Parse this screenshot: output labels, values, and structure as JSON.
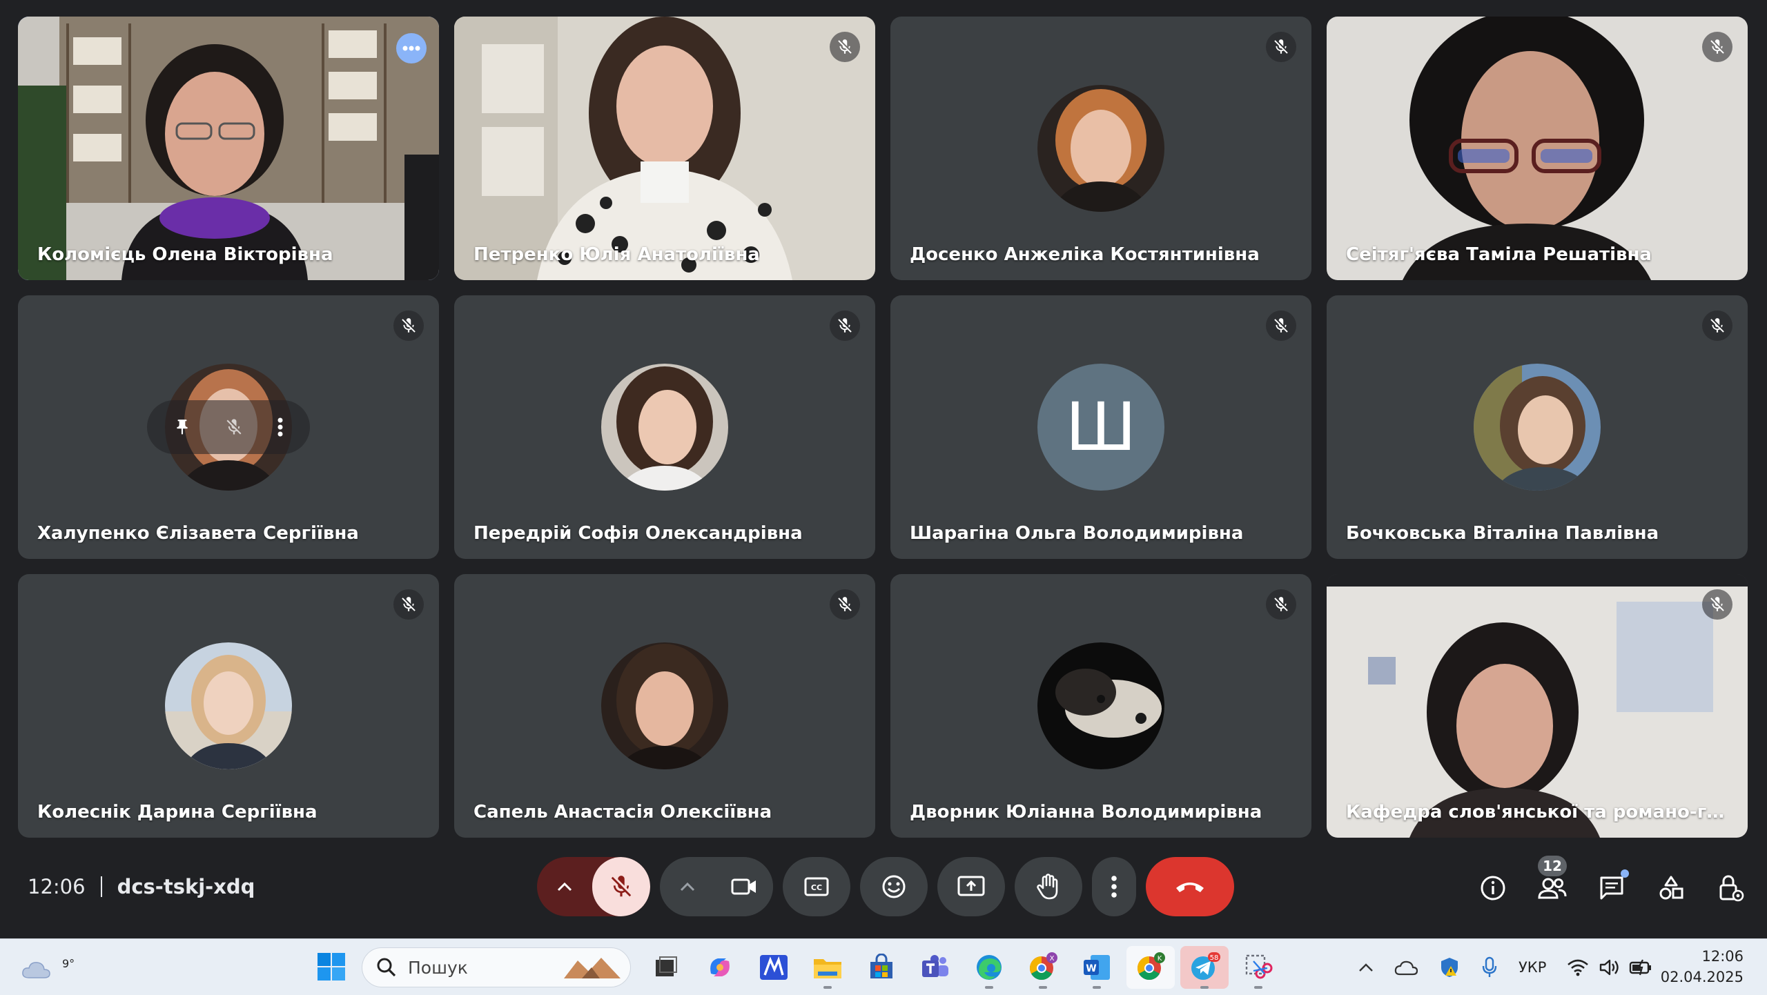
{
  "participants": [
    {
      "name": "Коломієць Олена Вікторівна",
      "type": "video",
      "muted": false,
      "active_speaker": true
    },
    {
      "name": "Петренко Юлія Анатоліївна",
      "type": "video",
      "muted": true
    },
    {
      "name": "Досенко Анжеліка Костянтинівна",
      "type": "avatar-photo",
      "muted": true
    },
    {
      "name": "Сеітяг'яєва Таміла Решатівна",
      "type": "video",
      "muted": true
    },
    {
      "name": "Халупенко Єлізавета Сергіївна",
      "type": "avatar-photo",
      "muted": true,
      "hovered": true
    },
    {
      "name": "Передрій Софія Олександрівна",
      "type": "avatar-photo",
      "muted": true
    },
    {
      "name": "Шарагіна Ольга Володимирівна",
      "type": "avatar-letter",
      "letter": "Ш",
      "muted": true
    },
    {
      "name": "Бочковська Віталіна Павлівна",
      "type": "avatar-photo",
      "muted": true
    },
    {
      "name": "Колеснік Дарина Сергіївна",
      "type": "avatar-photo",
      "muted": true
    },
    {
      "name": "Сапель Анастасія Олексіївна",
      "type": "avatar-photo",
      "muted": true
    },
    {
      "name": "Дворник Юліанна Володимирівна",
      "type": "avatar-photo",
      "muted": true
    },
    {
      "name": "Кафедра слов'янської та романо-германсь...",
      "type": "video",
      "muted": true
    }
  ],
  "meeting": {
    "time": "12:06",
    "code": "dcs-tskj-xdq",
    "participant_count": "12"
  },
  "controls": {
    "icons": [
      "chevron-up-icon",
      "mic-off-icon",
      "chevron-up-icon",
      "videocam-icon",
      "closed-caption-icon",
      "emoji-icon",
      "present-screen-icon",
      "raise-hand-icon",
      "more-vert-icon",
      "call-end-icon"
    ]
  },
  "right_tools": {
    "icons": [
      "info-icon",
      "people-icon",
      "chat-icon",
      "activities-icon",
      "host-controls-icon"
    ]
  },
  "taskbar": {
    "weather_temp": "9°",
    "search_placeholder": "Пошук",
    "telegram_badge": "58",
    "lang": "УКР",
    "clock_time": "12:06",
    "clock_date": "02.04.2025"
  },
  "colors": {
    "background": "#202124",
    "tile": "#3c4043",
    "active_outline": "#8ab4f8",
    "end_call": "#dc362e",
    "mic_off_bg": "#f9dedc"
  }
}
